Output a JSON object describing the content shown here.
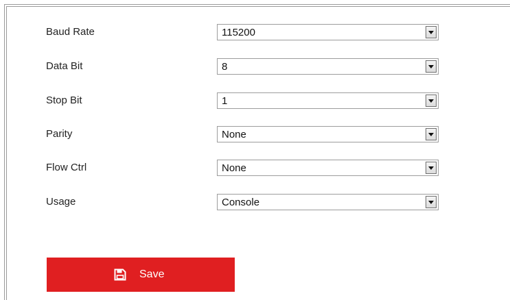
{
  "form": {
    "rows": [
      {
        "label": "Baud Rate",
        "value": "115200"
      },
      {
        "label": "Data Bit",
        "value": "8"
      },
      {
        "label": "Stop Bit",
        "value": "1"
      },
      {
        "label": "Parity",
        "value": "None"
      },
      {
        "label": "Flow Ctrl",
        "value": "None"
      },
      {
        "label": "Usage",
        "value": "Console"
      }
    ]
  },
  "actions": {
    "save_label": "Save",
    "save_icon": "floppy-disk-icon",
    "save_color": "#e01f21"
  }
}
